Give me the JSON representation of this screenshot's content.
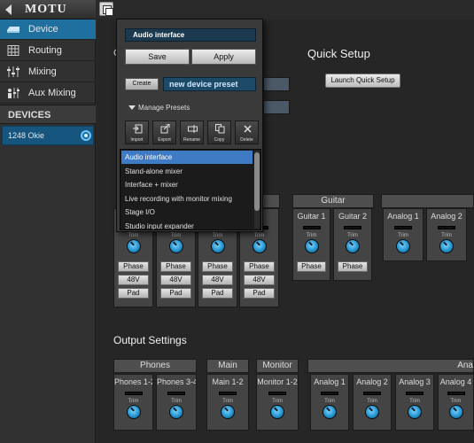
{
  "app": {
    "brand": "MOTU"
  },
  "sidebar": {
    "items": [
      {
        "label": "Device",
        "icon": "device-icon",
        "active": true
      },
      {
        "label": "Routing",
        "icon": "routing-grid-icon",
        "active": false
      },
      {
        "label": "Mixing",
        "icon": "mixer-faders-icon",
        "active": false
      },
      {
        "label": "Aux Mixing",
        "icon": "aux-mix-icon",
        "active": false
      }
    ],
    "devices_header": "DEVICES",
    "device": {
      "name": "1248 Okie",
      "selected": true
    }
  },
  "main": {
    "quick_setup_title": "Quick Setup",
    "launch_quick_setup": "Launch Quick Setup",
    "obscured_label_1": "C",
    "input_groups": [
      {
        "name": "Guitar"
      }
    ],
    "input_strips": [
      {
        "label": "",
        "trim": "Trim",
        "buttons": [
          "Phase",
          "48V",
          "Pad"
        ]
      },
      {
        "label": "",
        "trim": "Trim",
        "buttons": [
          "Phase",
          "48V",
          "Pad"
        ]
      },
      {
        "label": "",
        "trim": "Trim",
        "buttons": [
          "Phase",
          "48V",
          "Pad"
        ]
      },
      {
        "label": "",
        "trim": "Trim",
        "buttons": [
          "Phase",
          "48V",
          "Pad"
        ]
      },
      {
        "label": "Guitar 1",
        "trim": "Trim",
        "buttons": [
          "Phase"
        ]
      },
      {
        "label": "Guitar 2",
        "trim": "Trim",
        "buttons": [
          "Phase"
        ]
      },
      {
        "label": "Analog 1",
        "trim": "Trim",
        "buttons": []
      },
      {
        "label": "Analog 2",
        "trim": "Trim",
        "buttons": []
      }
    ],
    "output_title": "Output Settings",
    "output_groups": [
      {
        "name": "Phones"
      },
      {
        "name": "Main"
      },
      {
        "name": "Monitor"
      },
      {
        "name": "Ana"
      }
    ],
    "output_strips": [
      {
        "label": "Phones 1-2",
        "trim": "Trim"
      },
      {
        "label": "Phones 3-4",
        "trim": "Trim"
      },
      {
        "label": "Main 1-2",
        "trim": "Trim"
      },
      {
        "label": "Monitor 1-2",
        "trim": "Trim"
      },
      {
        "label": "Analog 1",
        "trim": "Trim"
      },
      {
        "label": "Analog 2",
        "trim": "Trim"
      },
      {
        "label": "Analog 3",
        "trim": "Trim"
      },
      {
        "label": "Analog 4",
        "trim": "Trim"
      }
    ]
  },
  "preset_popup": {
    "current_preset": "Audio interface",
    "save_label": "Save",
    "apply_label": "Apply",
    "create_label": "Create",
    "new_preset_value": "new device preset",
    "manage_label": "Manage Presets",
    "tools": [
      {
        "label": "Import",
        "icon": "import-icon"
      },
      {
        "label": "Export",
        "icon": "export-icon"
      },
      {
        "label": "Rename",
        "icon": "rename-icon"
      },
      {
        "label": "Copy",
        "icon": "copy-icon"
      },
      {
        "label": "Delete",
        "icon": "delete-icon"
      }
    ],
    "presets": [
      {
        "label": "Audio interface",
        "selected": true
      },
      {
        "label": "Stand-alone mixer",
        "selected": false
      },
      {
        "label": "Interface + mixer",
        "selected": false
      },
      {
        "label": "Live recording with monitor mixing",
        "selected": false
      },
      {
        "label": "Stage I/O",
        "selected": false
      },
      {
        "label": "Studio input expander",
        "selected": false
      }
    ]
  },
  "colors": {
    "accent": "#1f6f9f",
    "list_selection": "#3e7bc4",
    "knob": "#2594cf"
  }
}
